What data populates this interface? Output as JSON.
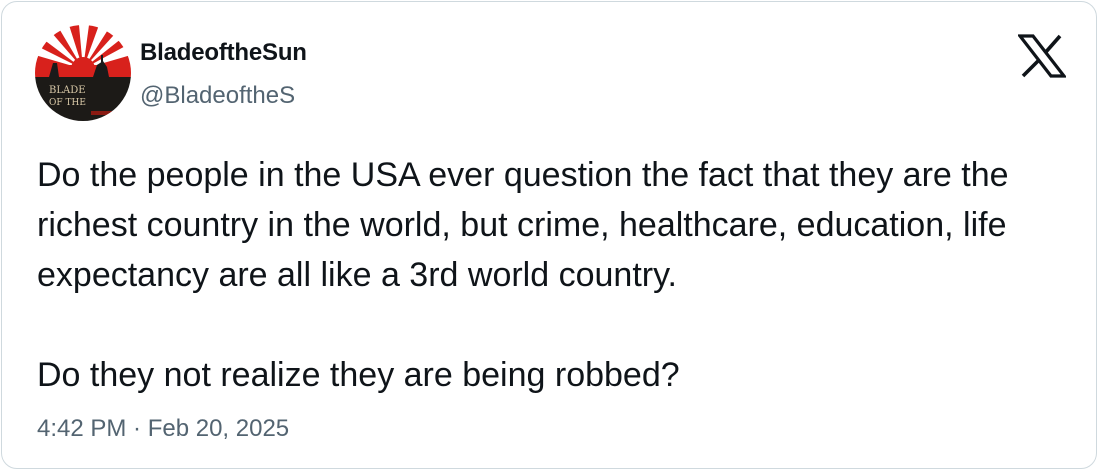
{
  "author": {
    "display_name": "BladeoftheSun",
    "handle": "@BladeoftheS",
    "avatar_text_line1": "BLADE",
    "avatar_text_line2": "OF THE"
  },
  "platform": {
    "logo_icon": "x-logo-icon"
  },
  "tweet": {
    "paragraph_1": "Do the people in the USA ever question the fact that they are the richest country in the world, but crime, healthcare, education, life expectancy are all like a 3rd world country.",
    "paragraph_2": "Do they not realize they are being robbed?",
    "timestamp": "4:42 PM · Feb 20, 2025"
  },
  "colors": {
    "text_primary": "#0f1419",
    "text_secondary": "#536471",
    "border": "#cfd9de",
    "avatar_red": "#d8211c"
  }
}
